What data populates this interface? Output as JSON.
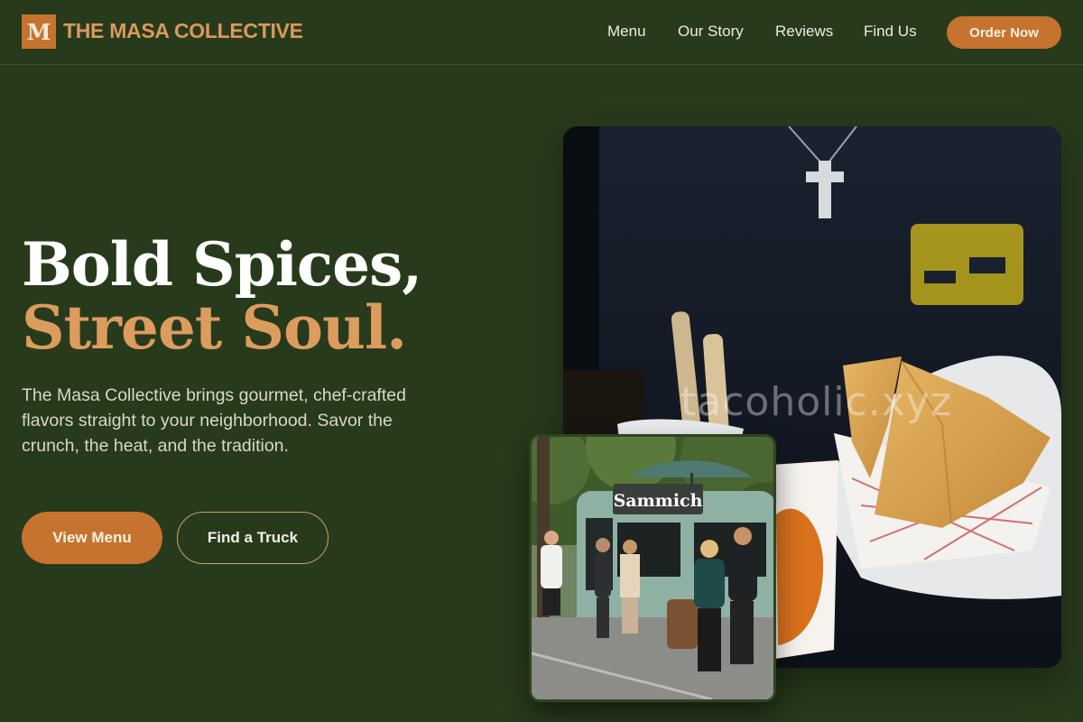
{
  "brand": {
    "mark": "M",
    "name": "THE MASA COLLECTIVE"
  },
  "nav": {
    "links": [
      "Menu",
      "Our Story",
      "Reviews",
      "Find Us"
    ],
    "cta": "Order Now"
  },
  "hero": {
    "title_line1": "Bold Spices,",
    "title_line2": "Street Soul.",
    "description": "The Masa Collective brings gourmet, chef-crafted flavors straight to your neighborhood. Savor the crunch, the heat, and the tradition.",
    "primary_button": "View Menu",
    "secondary_button": "Find a Truck"
  },
  "images": {
    "main_watermark": "tacoholic.xyz",
    "truck_sign": "Sammich"
  },
  "colors": {
    "background": "#283a1c",
    "accent": "#c5732e",
    "accent_text": "#dc9c5e"
  }
}
